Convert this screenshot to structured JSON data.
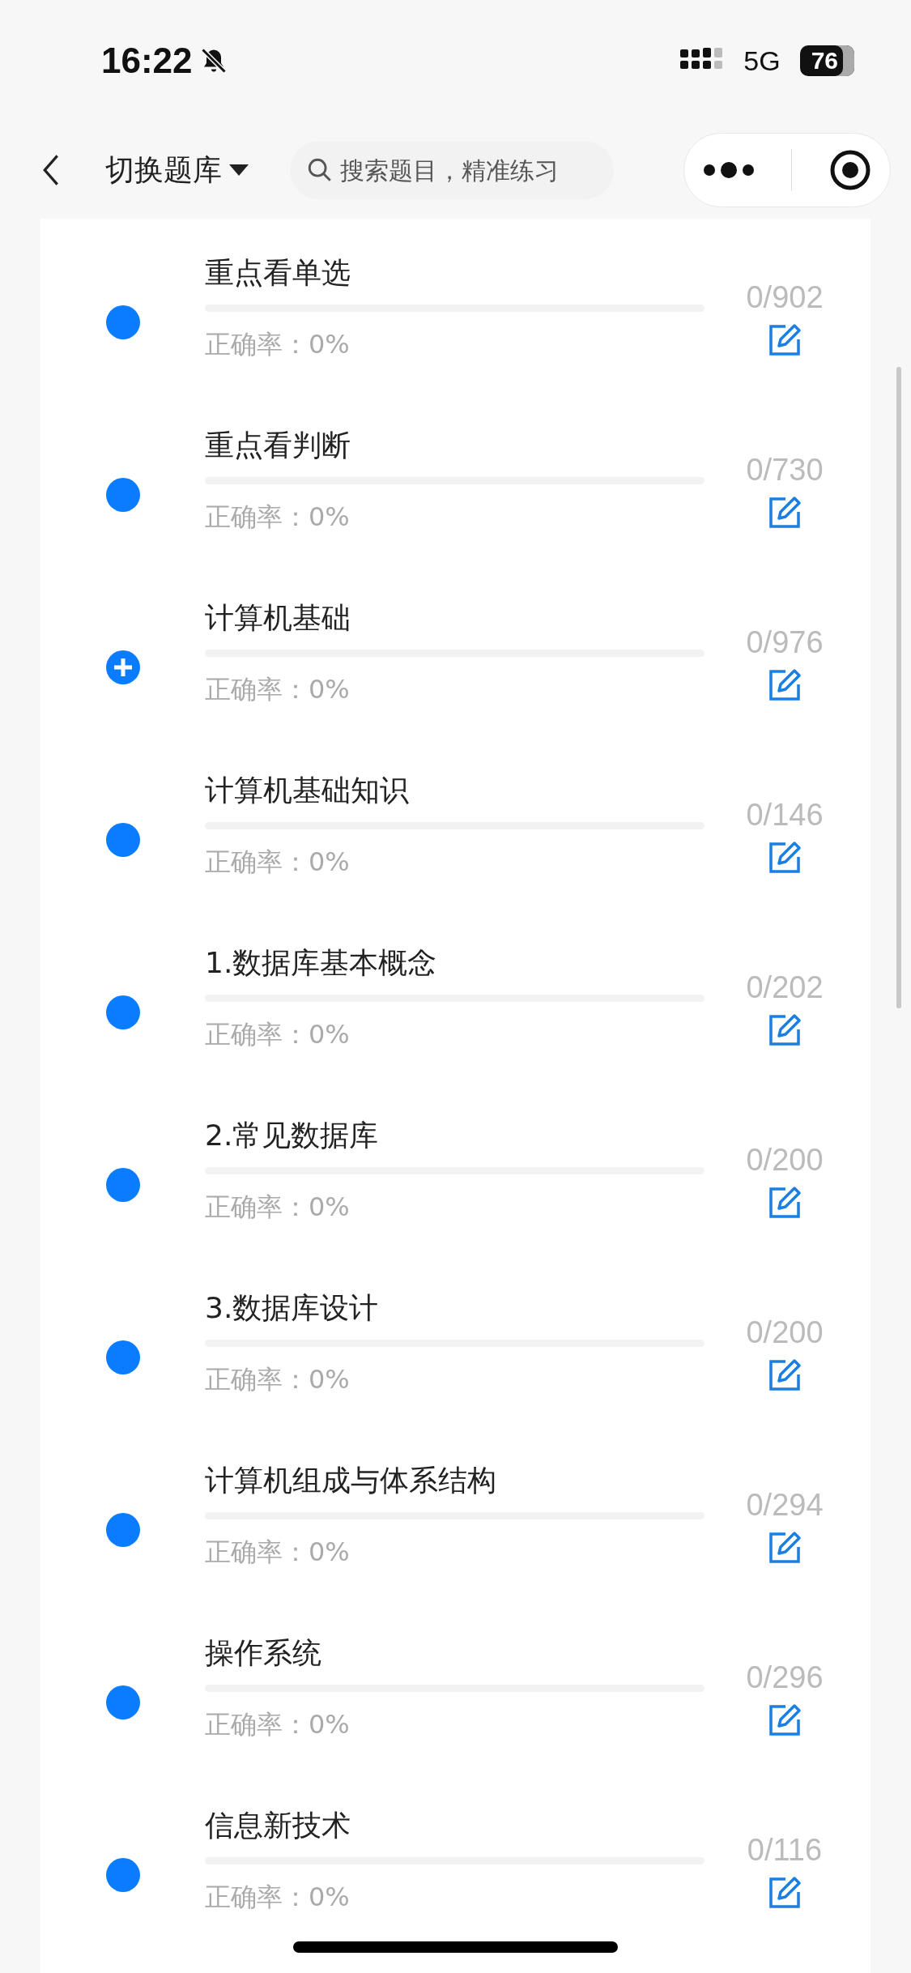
{
  "status_bar": {
    "time": "16:22",
    "network": "5G",
    "battery": "76"
  },
  "nav": {
    "title": "切换题库",
    "search": {
      "placeholder": "搜索题目，精准练习"
    }
  },
  "items": [
    {
      "kind": "dot",
      "title": "重点看单选",
      "accuracy": "正确率：0%",
      "count": "0/902"
    },
    {
      "kind": "dot",
      "title": "重点看判断",
      "accuracy": "正确率：0%",
      "count": "0/730"
    },
    {
      "kind": "plus",
      "title": "计算机基础",
      "accuracy": "正确率：0%",
      "count": "0/976"
    },
    {
      "kind": "dot",
      "title": "计算机基础知识",
      "accuracy": "正确率：0%",
      "count": "0/146"
    },
    {
      "kind": "dot",
      "title": "1.数据库基本概念",
      "accuracy": "正确率：0%",
      "count": "0/202"
    },
    {
      "kind": "dot",
      "title": "2.常见数据库",
      "accuracy": "正确率：0%",
      "count": "0/200"
    },
    {
      "kind": "dot",
      "title": "3.数据库设计",
      "accuracy": "正确率：0%",
      "count": "0/200"
    },
    {
      "kind": "dot",
      "title": "计算机组成与体系结构",
      "accuracy": "正确率：0%",
      "count": "0/294"
    },
    {
      "kind": "dot",
      "title": "操作系统",
      "accuracy": "正确率：0%",
      "count": "0/296"
    },
    {
      "kind": "dot",
      "title": "信息新技术",
      "accuracy": "正确率：0%",
      "count": "0/116"
    }
  ]
}
